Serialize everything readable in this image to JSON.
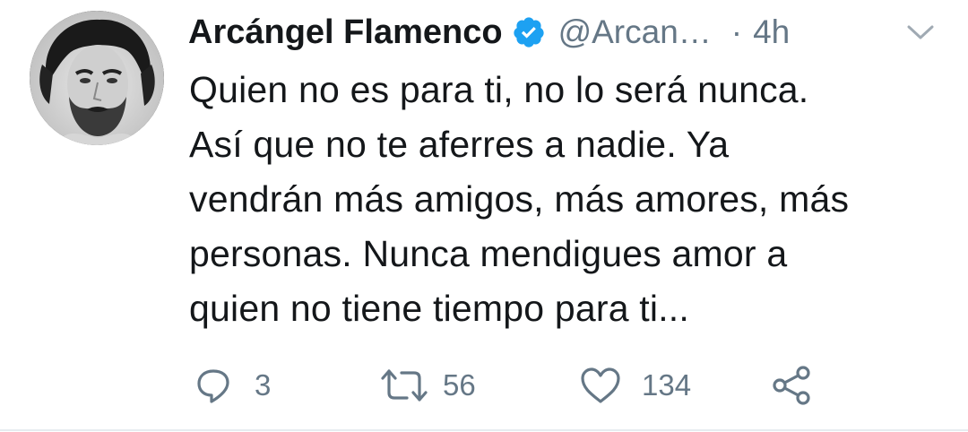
{
  "author": {
    "name": "Arcángel Flamenco",
    "handle": "@Arcan…",
    "separator": "·",
    "time": "4h",
    "avatar_icon": "profile-photo",
    "verified_icon": "verified-badge-icon",
    "verified_color": "#1da1f2"
  },
  "tweet": {
    "text": "Quien no es para ti, no lo será nunca.\nAsí que no te aferres a nadie. Ya\nvendrán más amigos, más amores, más\npersonas. Nunca mendigues amor a\nquien no tiene tiempo para ti..."
  },
  "actions": {
    "reply_icon": "reply-icon",
    "reply_count": "3",
    "retweet_icon": "retweet-icon",
    "retweet_count": "56",
    "like_icon": "heart-icon",
    "like_count": "134",
    "share_icon": "share-icon"
  },
  "colors": {
    "text": "#14171a",
    "muted": "#657786",
    "accent": "#1da1f2"
  }
}
